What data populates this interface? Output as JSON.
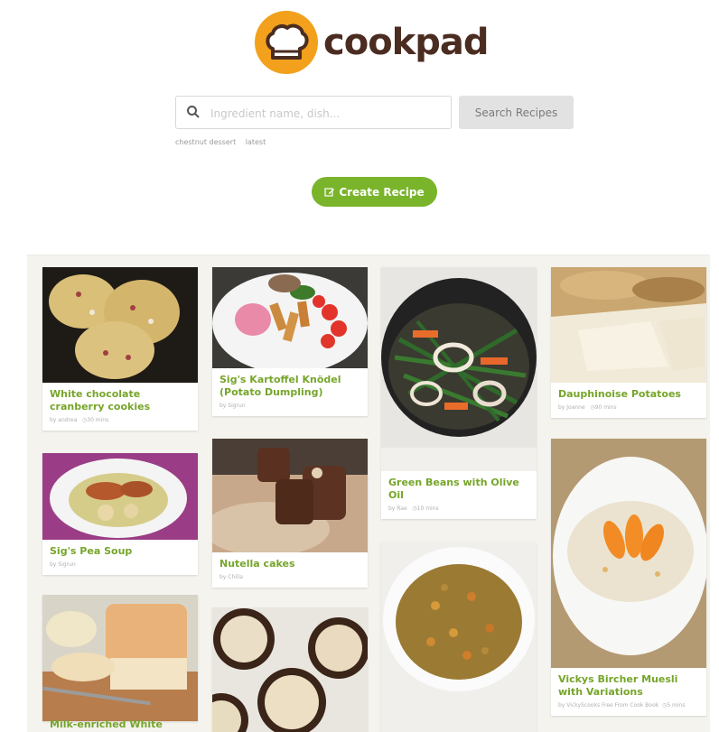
{
  "brand": {
    "name": "cookpad"
  },
  "search": {
    "placeholder": "Ingredient name, dish...",
    "button_label": "Search Recipes"
  },
  "suggestions": [
    "chestnut dessert",
    "latest"
  ],
  "create": {
    "label": "Create Recipe"
  },
  "recipes": [
    {
      "title": "White chocolate cranberry cookies",
      "author": "by andrea",
      "time": "30 mins"
    },
    {
      "title": "Sig's Pea Soup",
      "author": "by Sigrun",
      "time": ""
    },
    {
      "title": "Milk-enriched White",
      "author": "",
      "time": ""
    },
    {
      "title": "Sig's Kartoffel Knödel (Potato Dumpling)",
      "author": "by Sigrun",
      "time": ""
    },
    {
      "title": "Nutella cakes",
      "author": "by Chilla",
      "time": ""
    },
    {
      "title": "Green Beans with Olive Oil",
      "author": "by Rae",
      "time": "10 mins"
    },
    {
      "title": "Dauphinoise Potatoes",
      "author": "by Joanne",
      "time": "90 mins"
    },
    {
      "title": "Vickys Bircher Muesli with Variations",
      "author": "by VickyScooks Free From Cook Book",
      "time": "5 mins"
    }
  ]
}
